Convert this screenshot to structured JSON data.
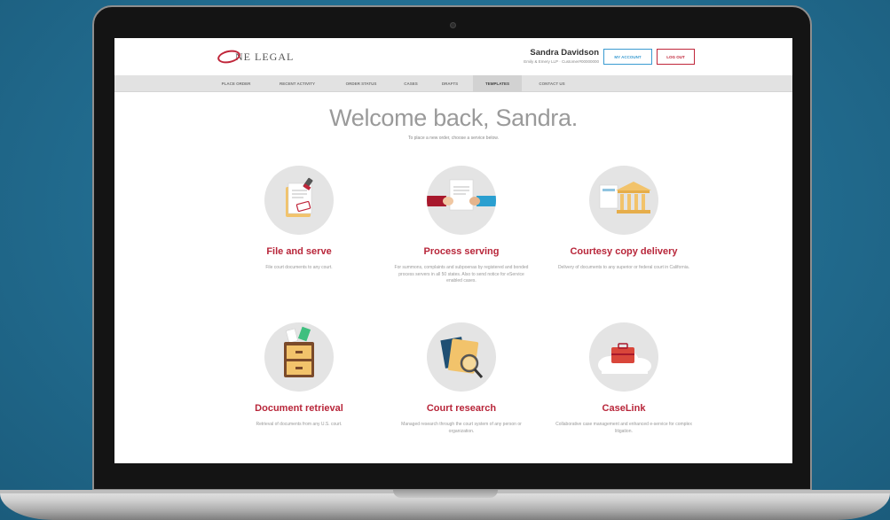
{
  "header": {
    "logo_text": "NE LEGAL",
    "user_name": "Sandra Davidson",
    "user_sub": "Emily & Emery LLP · Customer#00000000",
    "account_button": "MY ACCOUNT",
    "logout_button": "LOG OUT"
  },
  "nav": {
    "items": [
      {
        "label": "PLACE ORDER"
      },
      {
        "label": "RECENT ACTIVITY"
      },
      {
        "label": "ORDER STATUS"
      },
      {
        "label": "CASES"
      },
      {
        "label": "DRAFTS"
      },
      {
        "label": "TEMPLATES"
      },
      {
        "label": "CONTACT US"
      }
    ],
    "active": "TEMPLATES"
  },
  "main": {
    "welcome": "Welcome back, Sandra.",
    "subtitle": "To place a new order, choose a service below."
  },
  "services": [
    {
      "title": "File and serve",
      "description": "File court documents to any court.",
      "icon": "file-and-serve-icon"
    },
    {
      "title": "Process serving",
      "description": "For summons, complaints and subpoenas by registered and bonded process servers in all 50 states. Also to send notice for eService enabled cases.",
      "icon": "process-serving-icon"
    },
    {
      "title": "Courtesy copy delivery",
      "description": "Delivery of documents to any superior or federal court in California.",
      "icon": "courthouse-icon"
    },
    {
      "title": "Document retrieval",
      "description": "Retrieval of documents from any U.S. court.",
      "icon": "file-cabinet-icon"
    },
    {
      "title": "Court research",
      "description": "Managed research through the court system of any person or organization.",
      "icon": "magnifier-folder-icon"
    },
    {
      "title": "CaseLink",
      "description": "Collaborative case management and enhanced e-service for complex litigation.",
      "icon": "cloud-briefcase-icon"
    }
  ],
  "colors": {
    "brand_red": "#b8263a",
    "accent_blue": "#3a9bd1",
    "background": "#236f93"
  }
}
